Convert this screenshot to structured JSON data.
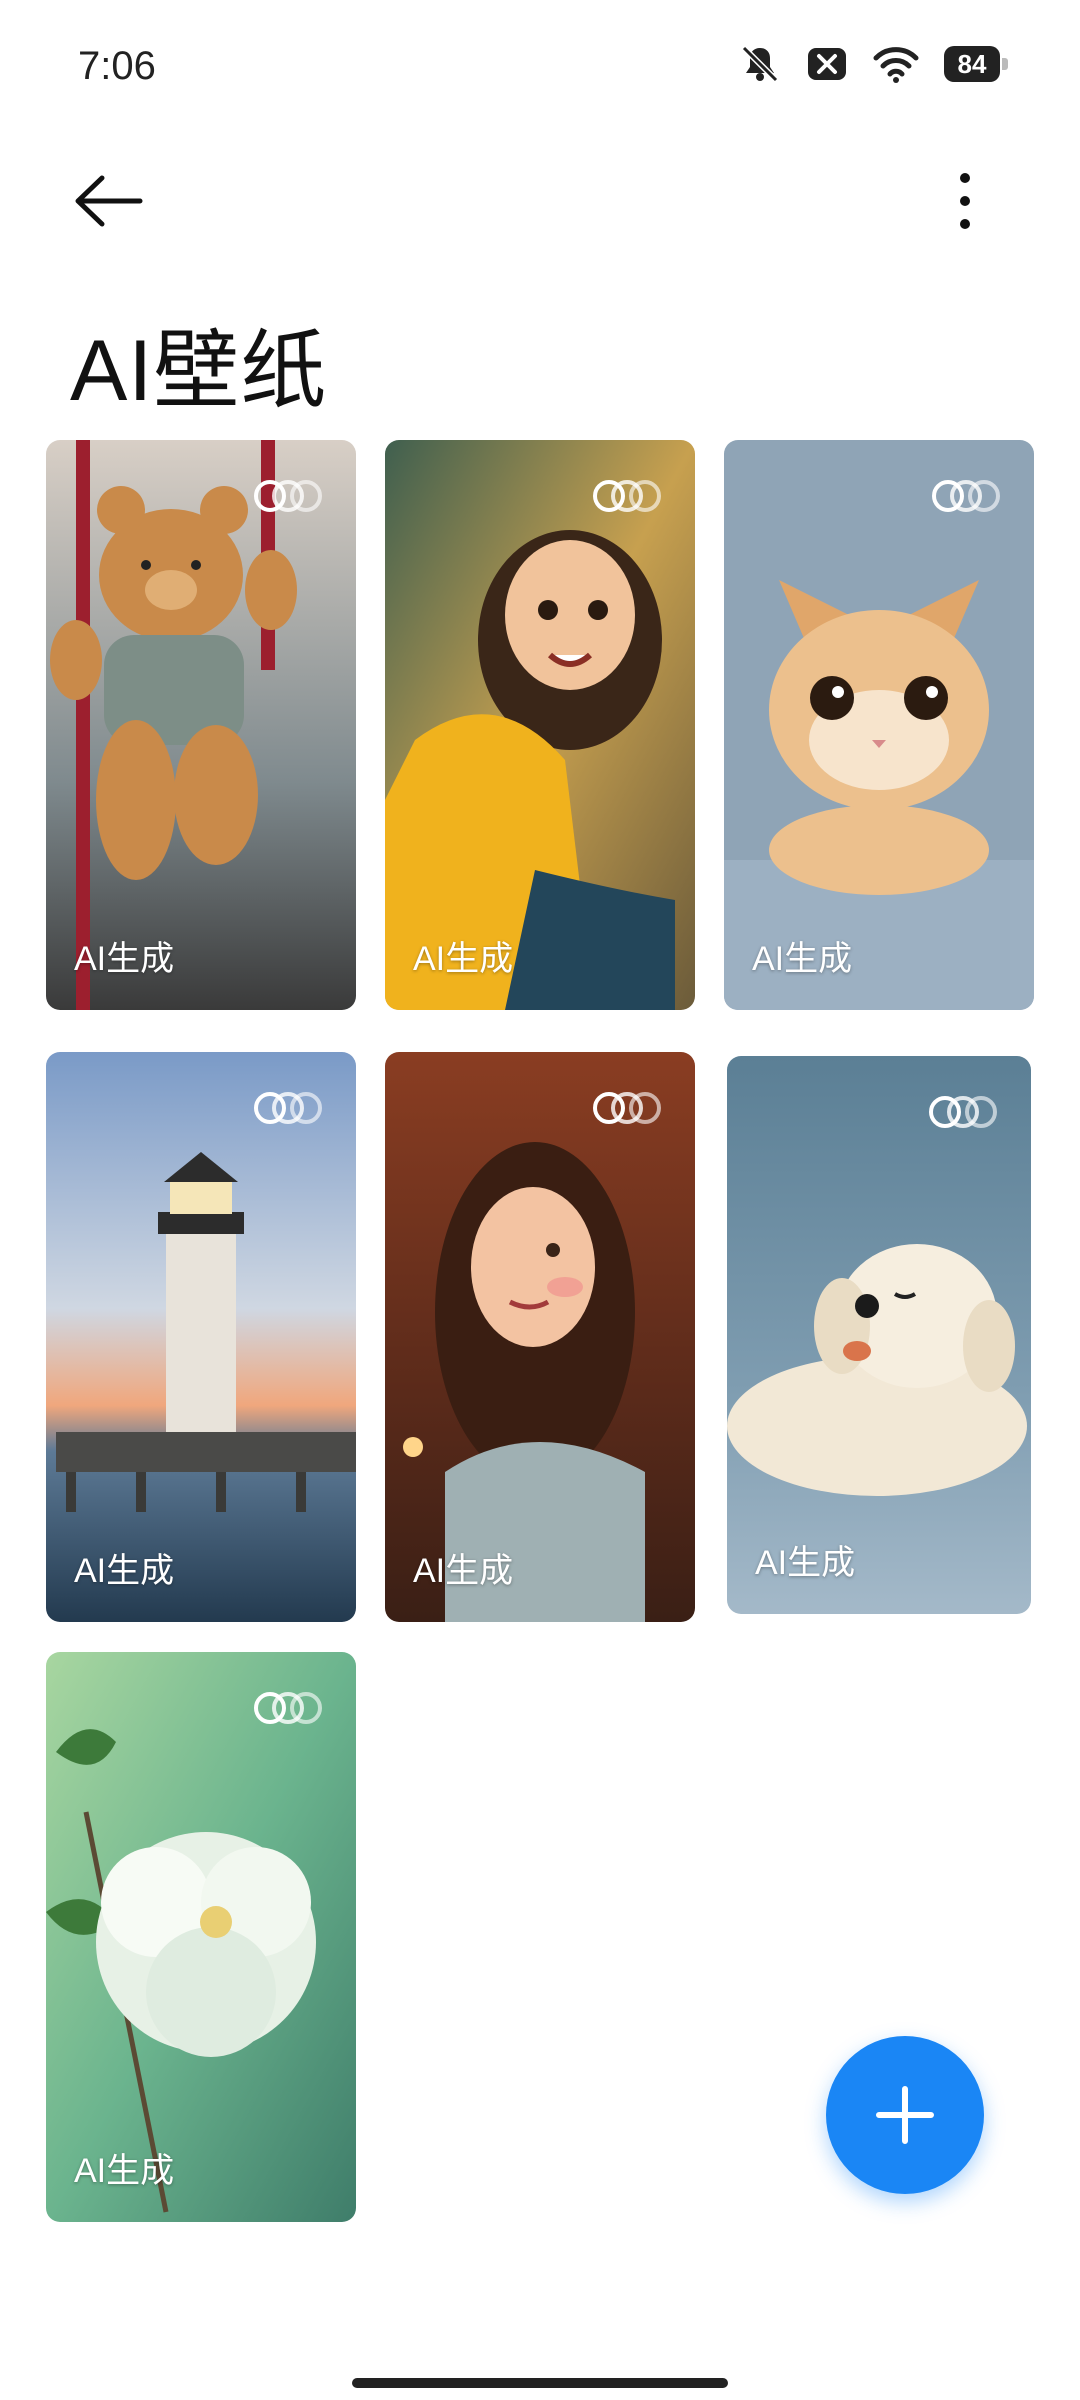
{
  "status_bar": {
    "time": "7:06",
    "battery_level": "84",
    "icons": [
      "bell-off-icon",
      "close-box-icon",
      "wifi-icon",
      "battery-icon"
    ]
  },
  "header": {
    "title": "AI壁纸"
  },
  "wallpapers": [
    {
      "label": "AI生成",
      "subject": "teddy-bear"
    },
    {
      "label": "AI生成",
      "subject": "girl-yellow-sweater"
    },
    {
      "label": "AI生成",
      "subject": "cat"
    },
    {
      "label": "AI生成",
      "subject": "lighthouse"
    },
    {
      "label": "AI生成",
      "subject": "woman-looking-up"
    },
    {
      "label": "AI生成",
      "subject": "puppy"
    },
    {
      "label": "AI生成",
      "subject": "white-flower"
    }
  ],
  "fab": {
    "icon": "plus-icon"
  },
  "colors": {
    "accent": "#1a86f5",
    "text": "#111111"
  }
}
